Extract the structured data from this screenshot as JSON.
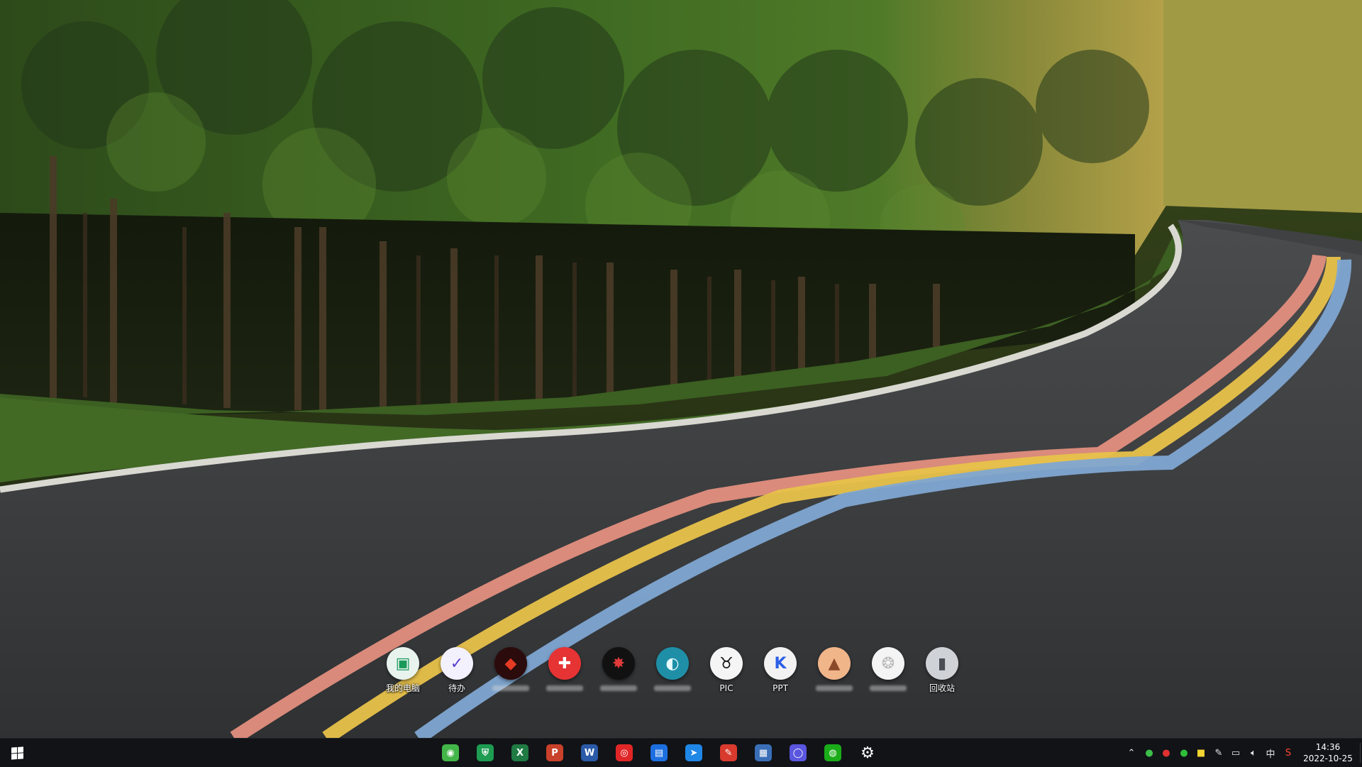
{
  "desktop": {
    "dock_items": [
      {
        "label": "我的电脑",
        "icon": "computer-shield-icon",
        "bg": "#e8f3ee",
        "fg": "#1a9a5a",
        "glyph": "▣"
      },
      {
        "label": "待办",
        "icon": "todo-clock-icon",
        "bg": "#f4f1ff",
        "fg": "#5b3fd1",
        "glyph": "✓"
      },
      {
        "label": "",
        "icon": "fox-app-icon",
        "bg": "#2b0b0b",
        "fg": "#e53a23",
        "glyph": "◆"
      },
      {
        "label": "",
        "icon": "red-app-icon",
        "bg": "#e63333",
        "fg": "#ffffff",
        "glyph": "✚"
      },
      {
        "label": "",
        "icon": "dark-star-app-icon",
        "bg": "#111111",
        "fg": "#e23a3a",
        "glyph": "✸"
      },
      {
        "label": "",
        "icon": "teal-wave-app-icon",
        "bg": "#1f8fa8",
        "fg": "#e8fbff",
        "glyph": "◐"
      },
      {
        "label": "PIC",
        "icon": "bull-head-icon",
        "bg": "#f5f5f5",
        "fg": "#111111",
        "glyph": "♉"
      },
      {
        "label": "PPT",
        "icon": "k-letter-icon",
        "bg": "#f2f2f2",
        "fg": "#2a5ee8",
        "glyph": "K"
      },
      {
        "label": "",
        "icon": "mountain-landscape-icon",
        "bg": "#f1b58a",
        "fg": "#8a4a2a",
        "glyph": "▲"
      },
      {
        "label": "",
        "icon": "lion-head-icon",
        "bg": "#f4f4f4",
        "fg": "#b9b9b9",
        "glyph": "❂"
      },
      {
        "label": "回收站",
        "icon": "recycle-bin-icon",
        "bg": "#cfd3d8",
        "fg": "#4a4f55",
        "glyph": "▮"
      }
    ]
  },
  "taskbar": {
    "start_icon": "windows-logo-icon",
    "apps": [
      {
        "icon": "green-browser-icon",
        "bg": "#43b649",
        "glyph": "◉"
      },
      {
        "icon": "green-shield-icon",
        "bg": "#1e9c52",
        "glyph": "⛨"
      },
      {
        "icon": "excel-icon",
        "bg": "#1f7a43",
        "glyph": "X"
      },
      {
        "icon": "powerpoint-icon",
        "bg": "#c9412a",
        "glyph": "P"
      },
      {
        "icon": "word-icon",
        "bg": "#2b5aa8",
        "glyph": "W"
      },
      {
        "icon": "netease-music-icon",
        "bg": "#e02626",
        "glyph": "◎"
      },
      {
        "icon": "blue-board-icon",
        "bg": "#1d6fe0",
        "glyph": "▤"
      },
      {
        "icon": "blue-arrow-icon",
        "bg": "#1f87e6",
        "glyph": "➤"
      },
      {
        "icon": "red-tools-icon",
        "bg": "#d83a2e",
        "glyph": "✎"
      },
      {
        "icon": "calculator-icon",
        "bg": "#3a6fb8",
        "glyph": "▦"
      },
      {
        "icon": "circle-app-icon",
        "bg": "#5a56e0",
        "glyph": "◯"
      },
      {
        "icon": "wechat-icon",
        "bg": "#1aad19",
        "glyph": "◍"
      },
      {
        "icon": "gear-icon",
        "bg": "transparent",
        "glyph": "⚙"
      }
    ],
    "tray": [
      {
        "icon": "chevron-up-icon",
        "glyph": "⌃",
        "color": "#e6e6e6"
      },
      {
        "icon": "green-tray-icon",
        "glyph": "●",
        "color": "#3cbf4a"
      },
      {
        "icon": "netease-tray-icon",
        "glyph": "●",
        "color": "#e03030"
      },
      {
        "icon": "wechat-tray-icon",
        "glyph": "●",
        "color": "#2fbf3a"
      },
      {
        "icon": "sticky-note-icon",
        "glyph": "■",
        "color": "#f2d531"
      },
      {
        "icon": "pen-tray-icon",
        "glyph": "✎",
        "color": "#e6e6e6"
      },
      {
        "icon": "network-icon",
        "glyph": "▭",
        "color": "#e6e6e6"
      },
      {
        "icon": "volume-icon",
        "glyph": "🔈︎",
        "color": "#e6e6e6"
      },
      {
        "icon": "ime-indicator",
        "glyph": "中",
        "color": "#e6e6e6"
      },
      {
        "icon": "sogou-input-icon",
        "glyph": "S",
        "color": "#ff4a2a"
      }
    ],
    "clock": {
      "time": "14:36",
      "date": "2022-10-25"
    }
  }
}
